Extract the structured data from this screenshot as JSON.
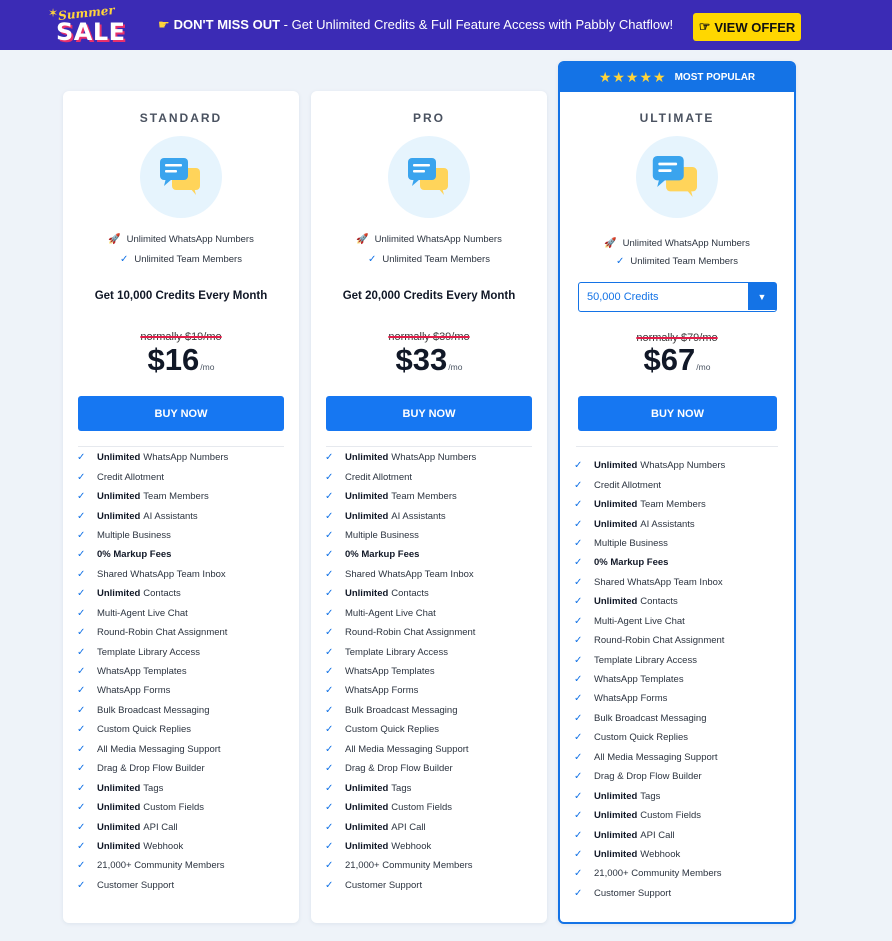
{
  "banner": {
    "logo_top": "Summer",
    "logo_bottom": "SALE",
    "lead": "DON'T MISS OUT",
    "message": " - Get Unlimited Credits & Full Feature Access with Pabbly Chatflow!",
    "offer_label": "VIEW OFFER"
  },
  "plans": [
    {
      "tier": "STANDARD",
      "highlight_1": "Unlimited WhatsApp Numbers",
      "highlight_2": "Unlimited Team Members",
      "credits": "Get 10,000 Credits Every Month",
      "normally": "normally $19/mo",
      "price": "$16",
      "per": "/mo",
      "buy": "BUY NOW"
    },
    {
      "tier": "PRO",
      "highlight_1": "Unlimited WhatsApp Numbers",
      "highlight_2": "Unlimited Team Members",
      "credits": "Get 20,000 Credits Every Month",
      "normally": "normally $39/mo",
      "price": "$33",
      "per": "/mo",
      "buy": "BUY NOW"
    },
    {
      "tier": "ULTIMATE",
      "badge": "MOST POPULAR",
      "highlight_1": "Unlimited WhatsApp Numbers",
      "highlight_2": "Unlimited Team Members",
      "credits_select": "50,000 Credits",
      "normally": "normally $79/mo",
      "price": "$67",
      "per": "/mo",
      "buy": "BUY NOW"
    }
  ],
  "features": [
    {
      "bold": "Unlimited",
      "text": "WhatsApp Numbers"
    },
    {
      "bold": "",
      "text": "Credit Allotment"
    },
    {
      "bold": "Unlimited",
      "text": "Team Members"
    },
    {
      "bold": "Unlimited",
      "text": "AI Assistants"
    },
    {
      "bold": "",
      "text": "Multiple Business"
    },
    {
      "bold": "0% Markup Fees",
      "text": ""
    },
    {
      "bold": "",
      "text": "Shared WhatsApp Team Inbox"
    },
    {
      "bold": "Unlimited",
      "text": "Contacts"
    },
    {
      "bold": "",
      "text": "Multi-Agent Live Chat"
    },
    {
      "bold": "",
      "text": "Round-Robin Chat Assignment"
    },
    {
      "bold": "",
      "text": "Template Library Access"
    },
    {
      "bold": "",
      "text": "WhatsApp Templates"
    },
    {
      "bold": "",
      "text": "WhatsApp Forms"
    },
    {
      "bold": "",
      "text": "Bulk Broadcast Messaging"
    },
    {
      "bold": "",
      "text": "Custom Quick Replies"
    },
    {
      "bold": "",
      "text": "All Media Messaging Support"
    },
    {
      "bold": "",
      "text": "Drag & Drop Flow Builder"
    },
    {
      "bold": "Unlimited",
      "text": "Tags"
    },
    {
      "bold": "Unlimited",
      "text": "Custom Fields"
    },
    {
      "bold": "Unlimited",
      "text": "API Call"
    },
    {
      "bold": "Unlimited",
      "text": "Webhook"
    },
    {
      "bold": "",
      "text": "21,000+ Community Members"
    },
    {
      "bold": "",
      "text": "Customer Support"
    }
  ],
  "colors": {
    "banner_bg": "#3b2bb5",
    "accent_blue": "#1473e6",
    "offer_yellow": "#ffd700",
    "strike_red": "#e11d48"
  },
  "icons": {
    "highlight_1": "rocket-icon",
    "highlight_2": "check-icon",
    "feature": "check-icon",
    "plan": "chat-bubbles-icon",
    "offer": "pointing-hand-icon"
  }
}
